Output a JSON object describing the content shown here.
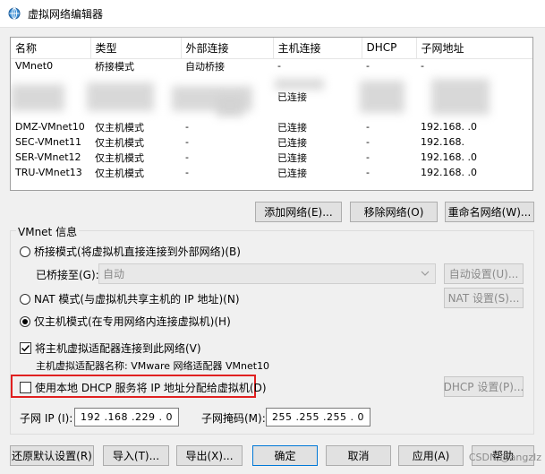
{
  "window": {
    "title": "虚拟网络编辑器",
    "icon": "network-editor-icon"
  },
  "table": {
    "columns": [
      "名称",
      "类型",
      "外部连接",
      "主机连接",
      "DHCP",
      "子网地址"
    ],
    "rows": [
      {
        "name": "VMnet0",
        "type": "桥接模式",
        "external": "自动桥接",
        "host": "-",
        "dhcp": "-",
        "subnet": "-"
      },
      {
        "name": "",
        "type": "",
        "external": "",
        "host": "",
        "dhcp": "",
        "subnet": ""
      },
      {
        "name": "",
        "type": "",
        "external": "",
        "host": "已连接",
        "dhcp": "",
        "subnet": ""
      },
      {
        "name": "",
        "type": "",
        "external": "",
        "host": "",
        "dhcp": "",
        "subnet": ""
      },
      {
        "name": "DMZ-VMnet10",
        "type": "仅主机模式",
        "external": "-",
        "host": "已连接",
        "dhcp": "-",
        "subnet": "192.168.    .0"
      },
      {
        "name": "SEC-VMnet11",
        "type": "仅主机模式",
        "external": "-",
        "host": "已连接",
        "dhcp": "-",
        "subnet": "192.168."
      },
      {
        "name": "SER-VMnet12",
        "type": "仅主机模式",
        "external": "-",
        "host": "已连接",
        "dhcp": "-",
        "subnet": "192.168.    .0"
      },
      {
        "name": "TRU-VMnet13",
        "type": "仅主机模式",
        "external": "-",
        "host": "已连接",
        "dhcp": "-",
        "subnet": "192.168.    .0"
      }
    ]
  },
  "table_actions": {
    "add": "添加网络(E)...",
    "remove": "移除网络(O)",
    "rename": "重命名网络(W)..."
  },
  "vmnet_info": {
    "legend": "VMnet 信息",
    "bridged_label": "桥接模式(将虚拟机直接连接到外部网络)(B)",
    "bridged_to_label": "已桥接至(G):",
    "bridged_to_value": "自动",
    "auto_settings": "自动设置(U)...",
    "nat_label": "NAT 模式(与虚拟机共享主机的 IP 地址)(N)",
    "nat_settings": "NAT 设置(S)...",
    "hostonly_label": "仅主机模式(在专用网络内连接虚拟机)(H)",
    "selected_mode": "hostonly",
    "connect_adapter_label": "将主机虚拟适配器连接到此网络(V)",
    "connect_adapter_checked": true,
    "adapter_name_text": "主机虚拟适配器名称: VMware 网络适配器 VMnet10",
    "dhcp_label": "使用本地 DHCP 服务将 IP 地址分配给虚拟机(D)",
    "dhcp_checked": false,
    "dhcp_settings": "DHCP 设置(P)...",
    "subnet_ip_label": "子网 IP (I):",
    "subnet_ip_value": "192 .168 .229 .  0",
    "subnet_mask_label": "子网掩码(M):",
    "subnet_mask_value": "255 .255 .255 .  0"
  },
  "footer": {
    "restore": "还原默认设置(R)",
    "import": "导入(T)...",
    "export": "导出(X)...",
    "ok": "确定",
    "cancel": "取消",
    "apply": "应用(A)",
    "help": "帮助"
  },
  "watermark": "CSDN @angzlz",
  "colors": {
    "highlight_border": "#e02020",
    "primary_border": "#0078d7",
    "window_bg": "#f0f0f0"
  }
}
